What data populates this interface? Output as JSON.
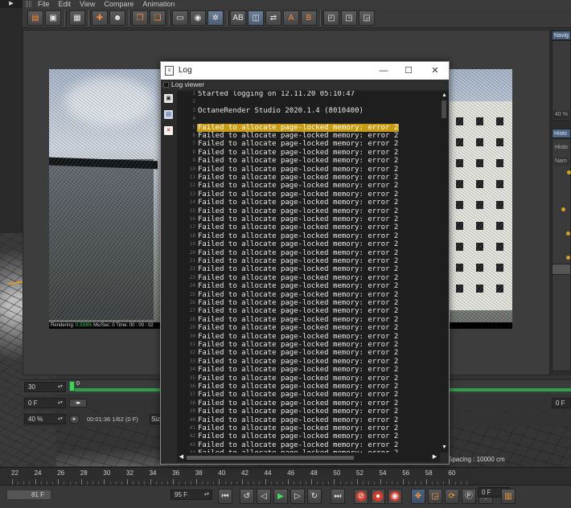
{
  "menubar": {
    "items": [
      "File",
      "Edit",
      "View",
      "Compare",
      "Animation"
    ]
  },
  "log_window": {
    "title": "Log",
    "controls": {
      "minimize": "—",
      "maximize": "☐",
      "close": "✕"
    },
    "viewer_label": "Log viewer",
    "lines": [
      {
        "n": "1",
        "text": "Started logging on 12.11.20 05:10:47",
        "highlight": false
      },
      {
        "n": "2",
        "text": "",
        "highlight": false
      },
      {
        "n": "3",
        "text": "OctaneRender Studio 2020.1.4 (8010400)",
        "highlight": false
      },
      {
        "n": "4",
        "text": "",
        "highlight": false
      },
      {
        "n": "5",
        "text": "Failed to allocate page-locked memory: error 2",
        "highlight": true
      },
      {
        "n": "6",
        "text": "Failed to allocate page-locked memory: error 2",
        "highlight": false
      },
      {
        "n": "7",
        "text": "Failed to allocate page-locked memory: error 2",
        "highlight": false
      },
      {
        "n": "8",
        "text": "Failed to allocate page-locked memory: error 2",
        "highlight": false
      },
      {
        "n": "9",
        "text": "Failed to allocate page-locked memory: error 2",
        "highlight": false
      },
      {
        "n": "10",
        "text": "Failed to allocate page-locked memory: error 2",
        "highlight": false
      },
      {
        "n": "11",
        "text": "Failed to allocate page-locked memory: error 2",
        "highlight": false
      },
      {
        "n": "12",
        "text": "Failed to allocate page-locked memory: error 2",
        "highlight": false
      },
      {
        "n": "13",
        "text": "Failed to allocate page-locked memory: error 2",
        "highlight": false
      },
      {
        "n": "14",
        "text": "Failed to allocate page-locked memory: error 2",
        "highlight": false
      },
      {
        "n": "15",
        "text": "Failed to allocate page-locked memory: error 2",
        "highlight": false
      },
      {
        "n": "16",
        "text": "Failed to allocate page-locked memory: error 2",
        "highlight": false
      },
      {
        "n": "17",
        "text": "Failed to allocate page-locked memory: error 2",
        "highlight": false
      },
      {
        "n": "18",
        "text": "Failed to allocate page-locked memory: error 2",
        "highlight": false
      },
      {
        "n": "19",
        "text": "Failed to allocate page-locked memory: error 2",
        "highlight": false
      },
      {
        "n": "20",
        "text": "Failed to allocate page-locked memory: error 2",
        "highlight": false
      },
      {
        "n": "21",
        "text": "Failed to allocate page-locked memory: error 2",
        "highlight": false
      },
      {
        "n": "22",
        "text": "Failed to allocate page-locked memory: error 2",
        "highlight": false
      },
      {
        "n": "23",
        "text": "Failed to allocate page-locked memory: error 2",
        "highlight": false
      },
      {
        "n": "24",
        "text": "Failed to allocate page-locked memory: error 2",
        "highlight": false
      },
      {
        "n": "25",
        "text": "Failed to allocate page-locked memory: error 2",
        "highlight": false
      },
      {
        "n": "26",
        "text": "Failed to allocate page-locked memory: error 2",
        "highlight": false
      },
      {
        "n": "27",
        "text": "Failed to allocate page-locked memory: error 2",
        "highlight": false
      },
      {
        "n": "28",
        "text": "Failed to allocate page-locked memory: error 2",
        "highlight": false
      },
      {
        "n": "29",
        "text": "Failed to allocate page-locked memory: error 2",
        "highlight": false
      },
      {
        "n": "30",
        "text": "Failed to allocate page-locked memory: error 2",
        "highlight": false
      },
      {
        "n": "31",
        "text": "Failed to allocate page-locked memory: error 2",
        "highlight": false
      },
      {
        "n": "32",
        "text": "Failed to allocate page-locked memory: error 2",
        "highlight": false
      },
      {
        "n": "33",
        "text": "Failed to allocate page-locked memory: error 2",
        "highlight": false
      },
      {
        "n": "34",
        "text": "Failed to allocate page-locked memory: error 2",
        "highlight": false
      },
      {
        "n": "35",
        "text": "Failed to allocate page-locked memory: error 2",
        "highlight": false
      },
      {
        "n": "36",
        "text": "Failed to allocate page-locked memory: error 2",
        "highlight": false
      },
      {
        "n": "37",
        "text": "Failed to allocate page-locked memory: error 2",
        "highlight": false
      },
      {
        "n": "38",
        "text": "Failed to allocate page-locked memory: error 2",
        "highlight": false
      },
      {
        "n": "39",
        "text": "Failed to allocate page-locked memory: error 2",
        "highlight": false
      },
      {
        "n": "40",
        "text": "Failed to allocate page-locked memory: error 2",
        "highlight": false
      },
      {
        "n": "41",
        "text": "Failed to allocate page-locked memory: error 2",
        "highlight": false
      },
      {
        "n": "42",
        "text": "Failed to allocate page-locked memory: error 2",
        "highlight": false
      },
      {
        "n": "43",
        "text": "Failed to allocate page-locked memory: error 2",
        "highlight": false
      },
      {
        "n": "44",
        "text": "Failed to allocate page-locked memory: error 2",
        "highlight": false
      }
    ]
  },
  "render_view": {
    "status_label": "Rendering:",
    "status_percent": "0.333%",
    "status_rest": "Ms/Sec: 0  Time: 00 : 00 : 02"
  },
  "right_panels": {
    "nav_tab": "Navig",
    "zoom_value": "40 %",
    "history_tab": "Histo",
    "history_sub": "Histo",
    "name_col": "Nam"
  },
  "timeline": {
    "frame_field": "30",
    "marker_label": "0",
    "offset_field": "0 F",
    "right_field": "0 F",
    "zoom_field": "40 %",
    "time_text": "00:01:36  1/62  (0 F)",
    "size_label": "Siz",
    "spacing_text": "Spacing : 10000 cm"
  },
  "ruler": {
    "labels": [
      "22",
      "24",
      "26",
      "28",
      "30",
      "32",
      "34",
      "36",
      "38",
      "40",
      "42",
      "44",
      "46",
      "48",
      "50",
      "52",
      "54",
      "56",
      "58",
      "60"
    ]
  },
  "transport": {
    "start_field": "81 F",
    "end_field": "95 F",
    "right_field": "0 F"
  },
  "colors": {
    "highlight": "#c89b10",
    "timeline_green": "#2f9d4a",
    "accent_blue": "#4b6380"
  }
}
